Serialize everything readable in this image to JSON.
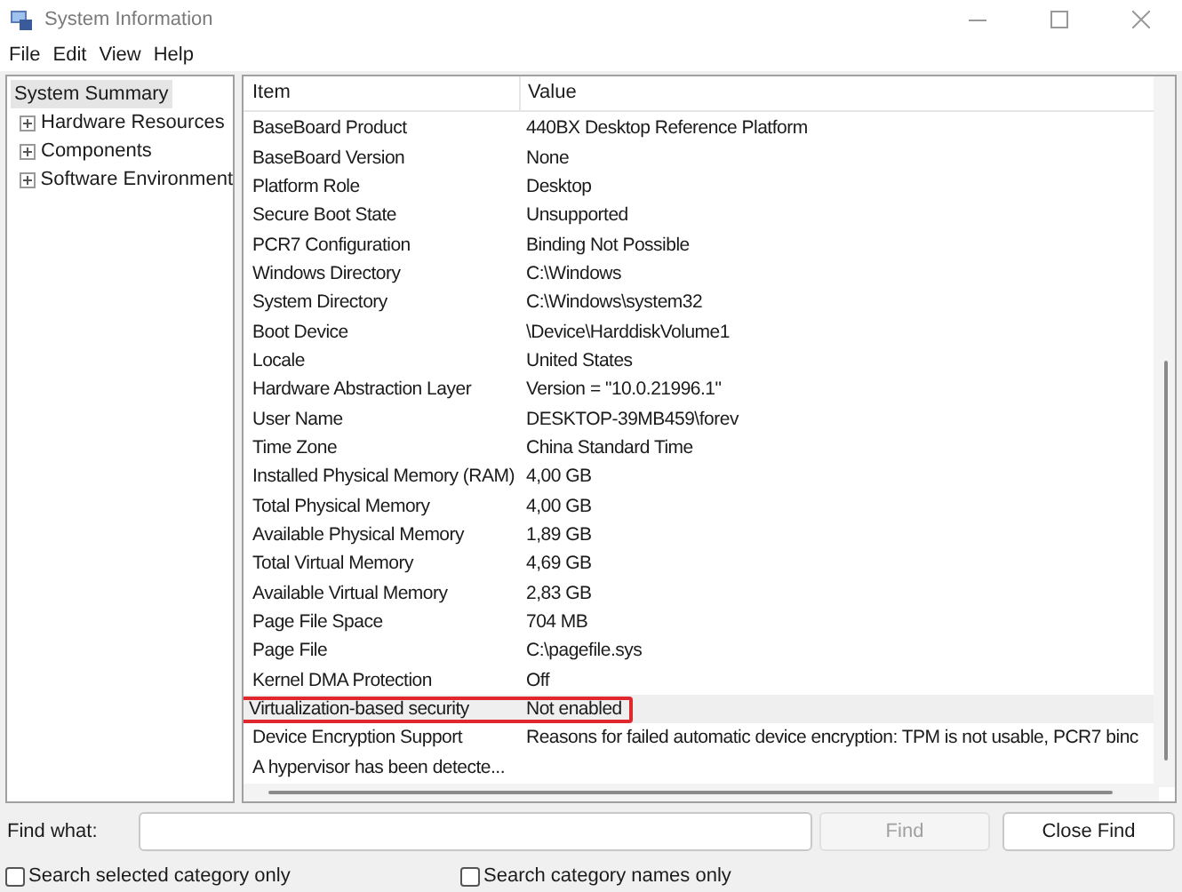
{
  "window": {
    "title": "System Information"
  },
  "menu": [
    "File",
    "Edit",
    "View",
    "Help"
  ],
  "tree": [
    {
      "label": "System Summary",
      "selected": true,
      "children": [
        {
          "label": "Hardware Resources",
          "expanded": false
        },
        {
          "label": "Components",
          "expanded": false
        },
        {
          "label": "Software Environment",
          "expanded": false
        }
      ]
    }
  ],
  "table": {
    "columns": [
      "Item",
      "Value"
    ],
    "rows": [
      {
        "item": "BaseBoard Product",
        "value": "440BX Desktop Reference Platform",
        "selected": false,
        "outlined": false
      },
      {
        "item": "BaseBoard Version",
        "value": "None",
        "selected": false,
        "outlined": false
      },
      {
        "item": "Platform Role",
        "value": "Desktop",
        "selected": false,
        "outlined": false
      },
      {
        "item": "Secure Boot State",
        "value": "Unsupported",
        "selected": false,
        "outlined": false
      },
      {
        "item": "PCR7 Configuration",
        "value": "Binding Not Possible",
        "selected": false,
        "outlined": false
      },
      {
        "item": "Windows Directory",
        "value": "C:\\Windows",
        "selected": false,
        "outlined": false
      },
      {
        "item": "System Directory",
        "value": "C:\\Windows\\system32",
        "selected": false,
        "outlined": false
      },
      {
        "item": "Boot Device",
        "value": "\\Device\\HarddiskVolume1",
        "selected": false,
        "outlined": false
      },
      {
        "item": "Locale",
        "value": "United States",
        "selected": false,
        "outlined": false
      },
      {
        "item": "Hardware Abstraction Layer",
        "value": "Version = \"10.0.21996.1\"",
        "selected": false,
        "outlined": false
      },
      {
        "item": "User Name",
        "value": "DESKTOP-39MB459\\forev",
        "selected": false,
        "outlined": false
      },
      {
        "item": "Time Zone",
        "value": "China Standard Time",
        "selected": false,
        "outlined": false
      },
      {
        "item": "Installed Physical Memory (RAM)",
        "value": "4,00 GB",
        "selected": false,
        "outlined": false
      },
      {
        "item": "Total Physical Memory",
        "value": "4,00 GB",
        "selected": false,
        "outlined": false
      },
      {
        "item": "Available Physical Memory",
        "value": "1,89 GB",
        "selected": false,
        "outlined": false
      },
      {
        "item": "Total Virtual Memory",
        "value": "4,69 GB",
        "selected": false,
        "outlined": false
      },
      {
        "item": "Available Virtual Memory",
        "value": "2,83 GB",
        "selected": false,
        "outlined": false
      },
      {
        "item": "Page File Space",
        "value": "704 MB",
        "selected": false,
        "outlined": false
      },
      {
        "item": "Page File",
        "value": "C:\\pagefile.sys",
        "selected": false,
        "outlined": false
      },
      {
        "item": "Kernel DMA Protection",
        "value": "Off",
        "selected": false,
        "outlined": false
      },
      {
        "item": "Virtualization-based security",
        "value": "Not enabled",
        "selected": true,
        "outlined": true
      },
      {
        "item": "Device Encryption Support",
        "value": "Reasons for failed automatic device encryption: TPM is not usable, PCR7 binc",
        "selected": false,
        "outlined": false
      },
      {
        "item": "A hypervisor has been detecte...",
        "selected": false,
        "outlined": false
      }
    ]
  },
  "find": {
    "label": "Find what:",
    "find_button": {
      "label": "Find",
      "disabled": true
    },
    "close_button": "Close Find",
    "options": [
      {
        "label": "Search selected category only",
        "checked": false
      },
      {
        "label": "Search category names only",
        "checked": false
      }
    ]
  }
}
